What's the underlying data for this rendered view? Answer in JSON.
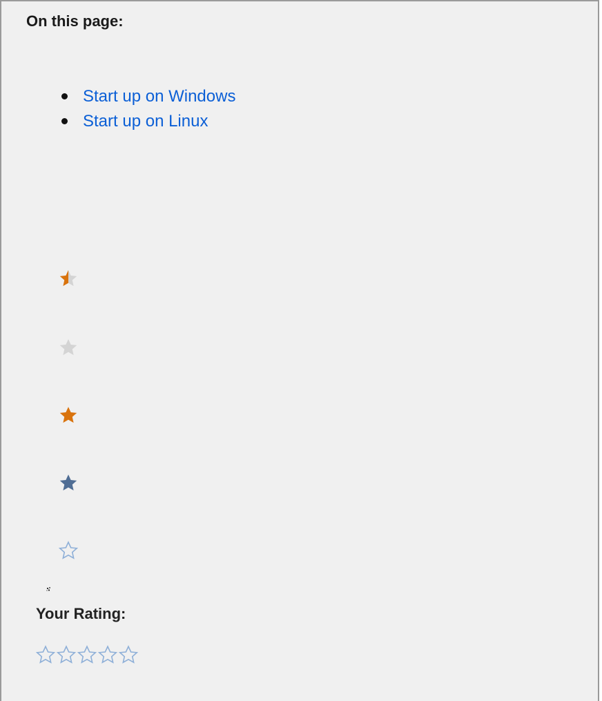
{
  "toc": {
    "heading": "On this page:",
    "items": [
      {
        "label": "Start up on Windows"
      },
      {
        "label": "Start up on Linux"
      }
    ]
  },
  "star_samples": [
    {
      "icon": "half-star-icon",
      "color_fill": "#d9730d",
      "color_empty": "#d4d4d4"
    },
    {
      "icon": "star-icon",
      "color_fill": "#d4d4d4"
    },
    {
      "icon": "star-icon",
      "color_fill": "#d9730d"
    },
    {
      "icon": "star-icon",
      "color_fill": "#4f6d94"
    },
    {
      "icon": "star-outline-icon",
      "color_stroke": "#8fb0d8"
    }
  ],
  "rating": {
    "label": "Your Rating:",
    "max_stars": 5,
    "value": 0,
    "star_icon": "star-outline-icon",
    "star_color": "#8fb0d8"
  }
}
